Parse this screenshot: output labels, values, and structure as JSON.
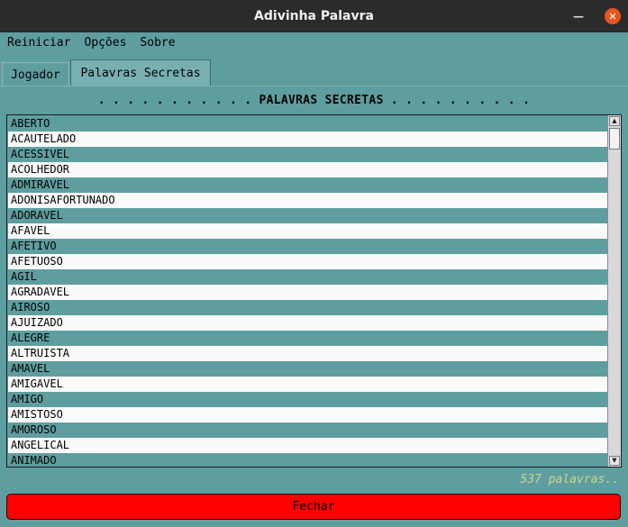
{
  "window": {
    "title": "Adivinha Palavra"
  },
  "window_controls": {
    "minimize": "—",
    "maximize": "□",
    "close": "✕"
  },
  "menu": [
    "Reiniciar",
    "Opções",
    "Sobre"
  ],
  "tabs": [
    {
      "label": "Jogador",
      "selected": false
    },
    {
      "label": "Palavras Secretas",
      "selected": true
    }
  ],
  "heading": ". . . . . . . . . . . PALAVRAS SECRETAS . . . . . . . . . .",
  "words": [
    "ABERTO",
    "ACAUTELADO",
    "ACESSIVEL",
    "ACOLHEDOR",
    "ADMIRAVEL",
    "ADONISAFORTUNADO",
    "ADORAVEL",
    "AFAVEL",
    "AFETIVO",
    "AFETUOSO",
    "AGIL",
    "AGRADAVEL",
    "AIROSO",
    "AJUIZADO",
    "ALEGRE",
    "ALTRUISTA",
    "AMAVEL",
    "AMIGAVEL",
    "AMIGO",
    "AMISTOSO",
    "AMOROSO",
    "ANGELICAL",
    "ANIMADO"
  ],
  "scrollbar": {
    "up": "▲",
    "down": "▼"
  },
  "count_text": "537 palavras..",
  "close_button": "Fechar",
  "colors": {
    "background": "#5f9ea0",
    "close_button": "#ff0000",
    "count_text": "#c9d98a",
    "titlebar": "#2b2b2b",
    "close_control": "#e95420"
  }
}
